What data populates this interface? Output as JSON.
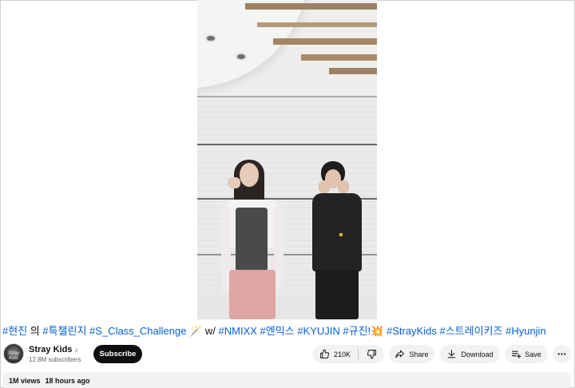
{
  "title": {
    "parts": [
      {
        "text": "#현진",
        "tag": true
      },
      {
        "text": " 의 ",
        "tag": false
      },
      {
        "text": "#특챌린지",
        "tag": true
      },
      {
        "text": " ",
        "tag": false
      },
      {
        "text": "#S_Class_Challenge",
        "tag": true
      },
      {
        "text": " ",
        "tag": false
      },
      {
        "text": "🪄",
        "tag": false
      },
      {
        "text": " w/ ",
        "tag": false
      },
      {
        "text": "#NMIXX",
        "tag": true
      },
      {
        "text": " ",
        "tag": false
      },
      {
        "text": "#엔믹스",
        "tag": true
      },
      {
        "text": " ",
        "tag": false
      },
      {
        "text": "#KYUJIN",
        "tag": true
      },
      {
        "text": " ",
        "tag": false
      },
      {
        "text": "#규진!",
        "tag": true
      },
      {
        "text": "💥",
        "tag": false
      },
      {
        "text": " ",
        "tag": false
      },
      {
        "text": "#StrayKids",
        "tag": true
      },
      {
        "text": " ",
        "tag": false
      },
      {
        "text": "#스트레이키즈",
        "tag": true
      },
      {
        "text": " ",
        "tag": false
      },
      {
        "text": "#Hyunjin",
        "tag": true
      }
    ]
  },
  "channel": {
    "name": "Stray Kids",
    "note_icon": "♪",
    "subscribers": "12.8M subscribers",
    "subscribe_label": "Subscribe",
    "avatar_mark": "Stray Kids"
  },
  "actions": {
    "like_count": "210K",
    "share_label": "Share",
    "download_label": "Download",
    "save_label": "Save"
  },
  "description": {
    "views": "1M views",
    "time": "18 hours ago"
  },
  "icons": {
    "like": "thumbs-up-icon",
    "dislike": "thumbs-down-icon",
    "share": "share-arrow-icon",
    "download": "download-icon",
    "save": "playlist-add-icon",
    "more": "more-horizontal-icon"
  },
  "colors": {
    "hashtag": "#065fd4",
    "subscribe_bg": "#0f0f0f",
    "pill_bg": "#f2f2f2"
  }
}
